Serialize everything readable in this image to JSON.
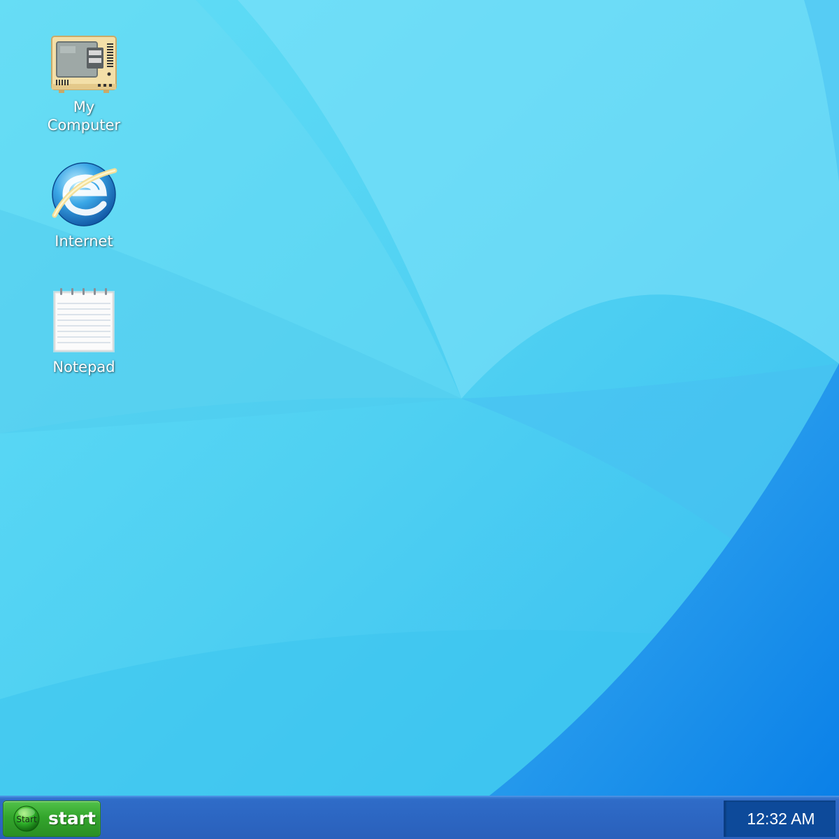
{
  "desktop": {
    "icons": [
      {
        "label": "My Computer",
        "icon": "computer-icon"
      },
      {
        "label": "Internet",
        "icon": "internet-explorer-icon"
      },
      {
        "label": "Notepad",
        "icon": "notepad-icon"
      }
    ]
  },
  "taskbar": {
    "start_orb_text": "Start",
    "start_label": "start",
    "clock": "12:32 AM"
  },
  "colors": {
    "wallpaper_light": "#6fdcf6",
    "wallpaper_mid": "#42c6f0",
    "wallpaper_deep": "#0f86ea",
    "taskbar": "#2c66c2",
    "start_green": "#33a52c",
    "tray": "#0d4a9a"
  }
}
